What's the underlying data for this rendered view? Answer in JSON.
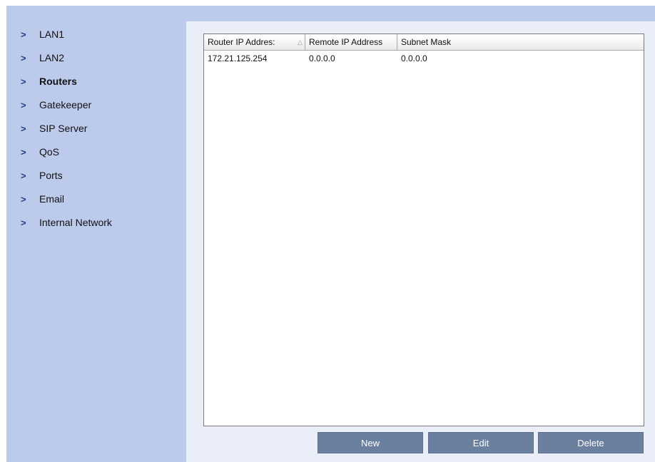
{
  "sidebar": {
    "items": [
      {
        "label": "LAN1",
        "active": false
      },
      {
        "label": "LAN2",
        "active": false
      },
      {
        "label": "Routers",
        "active": true
      },
      {
        "label": "Gatekeeper",
        "active": false
      },
      {
        "label": "SIP Server",
        "active": false
      },
      {
        "label": "QoS",
        "active": false
      },
      {
        "label": "Ports",
        "active": false
      },
      {
        "label": "Email",
        "active": false
      },
      {
        "label": "Internal Network",
        "active": false
      }
    ],
    "chevron": ">"
  },
  "table": {
    "columns": [
      "Router IP Addres:",
      "Remote IP Address",
      "Subnet Mask"
    ],
    "sort_indicator": "△",
    "rows": [
      [
        "172.21.125.254",
        "0.0.0.0",
        "0.0.0.0"
      ]
    ]
  },
  "buttons": {
    "new": "New",
    "edit": "Edit",
    "delete": "Delete"
  },
  "colors": {
    "sidebar_bg": "#bccaec",
    "content_bg": "#e9eef9",
    "button_bg": "#6b7f9f",
    "chevron": "#1f3d8a"
  }
}
